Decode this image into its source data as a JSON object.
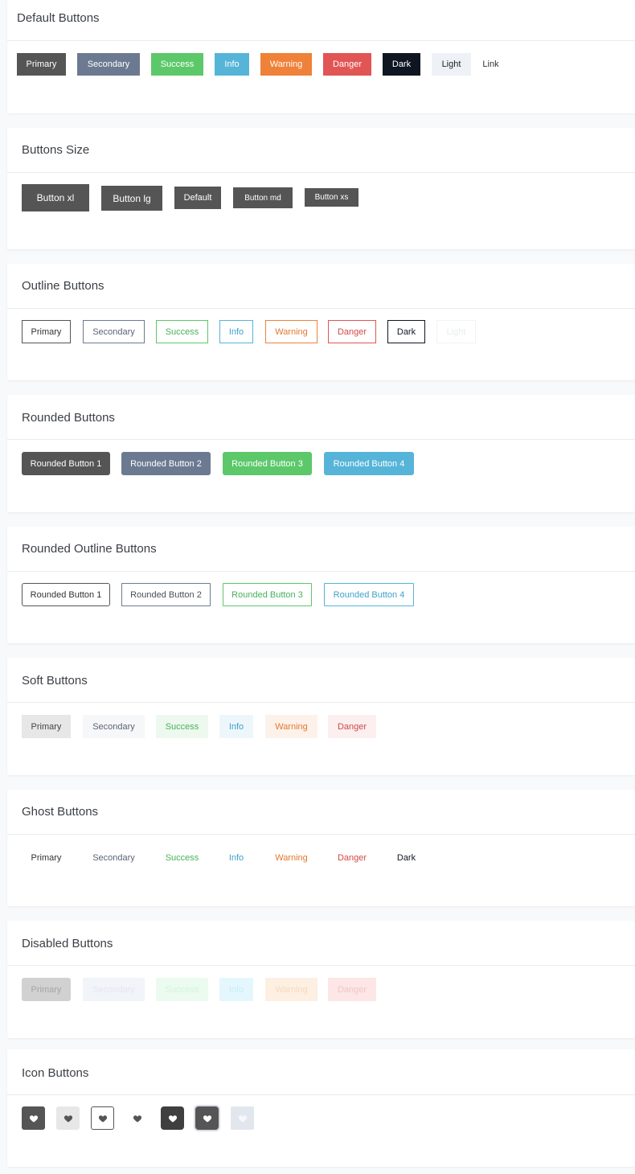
{
  "sections": {
    "default": {
      "title": "Default Buttons",
      "buttons": [
        "Primary",
        "Secondary",
        "Success",
        "Info",
        "Warning",
        "Danger",
        "Dark",
        "Light",
        "Link"
      ]
    },
    "size": {
      "title": "Buttons Size",
      "buttons": [
        "Button xl",
        "Button lg",
        "Default",
        "Button md",
        "Button xs"
      ]
    },
    "outline": {
      "title": "Outline Buttons",
      "buttons": [
        "Primary",
        "Secondary",
        "Success",
        "Info",
        "Warning",
        "Danger",
        "Dark",
        "Light"
      ]
    },
    "rounded": {
      "title": "Rounded Buttons",
      "buttons": [
        "Rounded Button 1",
        "Rounded Button 2",
        "Rounded Button 3",
        "Rounded Button 4"
      ]
    },
    "rounded_outline": {
      "title": "Rounded Outline Buttons",
      "buttons": [
        "Rounded Button 1",
        "Rounded Button 2",
        "Rounded Button 3",
        "Rounded Button 4"
      ]
    },
    "soft": {
      "title": "Soft Buttons",
      "buttons": [
        "Primary",
        "Secondary",
        "Success",
        "Info",
        "Warning",
        "Danger"
      ]
    },
    "ghost": {
      "title": "Ghost Buttons",
      "buttons": [
        "Primary",
        "Secondary",
        "Success",
        "Info",
        "Warning",
        "Danger",
        "Dark"
      ]
    },
    "disabled": {
      "title": "Disabled Buttons",
      "buttons": [
        "Primary",
        "Secondary",
        "Success",
        "Info",
        "Warning",
        "Danger"
      ]
    },
    "icon": {
      "title": "Icon Buttons",
      "icons": [
        "heart-icon",
        "heart-icon",
        "heart-icon",
        "heart-icon",
        "heart-icon",
        "heart-icon",
        "heart-icon"
      ]
    }
  },
  "colors": {
    "primary": "#555555",
    "secondary": "#6c7a91",
    "success": "#5cc86a",
    "info": "#56b4d8",
    "warning": "#ef8138",
    "danger": "#e15555",
    "dark": "#101522",
    "light": "#eef2f7"
  }
}
